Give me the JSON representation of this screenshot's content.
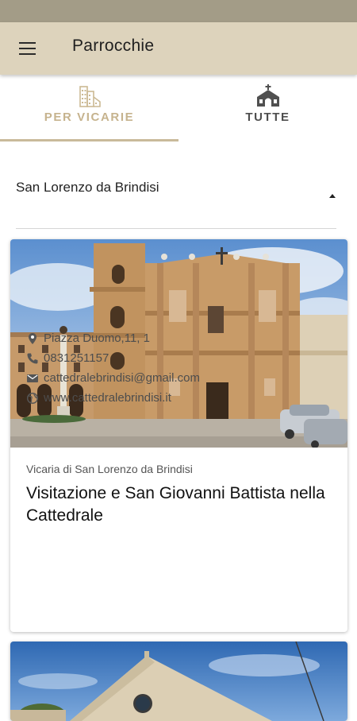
{
  "appbar": {
    "title": "Parrocchie",
    "menu_icon": "menu-icon"
  },
  "tabs": [
    {
      "label": "PER VICARIE",
      "icon": "buildings-icon",
      "active": true
    },
    {
      "label": "TUTTE",
      "icon": "church-icon",
      "active": false
    }
  ],
  "selector": {
    "value": "San Lorenzo da Brindisi",
    "icon": "arrow-up-icon"
  },
  "parishes": [
    {
      "vicaria": "Vicaria di San Lorenzo da Brindisi",
      "title": "Visitazione e San Giovanni Battista nella Cattedrale",
      "address": "Piazza Duomo,11, 1",
      "phone": "0831251157",
      "email": "cattedralebrindisi@gmail.com",
      "website": "www.cattedralebrindisi.it",
      "icons": [
        "location-pin-icon",
        "phone-icon",
        "email-icon",
        "globe-icon"
      ]
    }
  ],
  "colors": {
    "statusbar": "#a39c87",
    "appbar": "#ddd3bc",
    "accent": "#c6b38e"
  }
}
